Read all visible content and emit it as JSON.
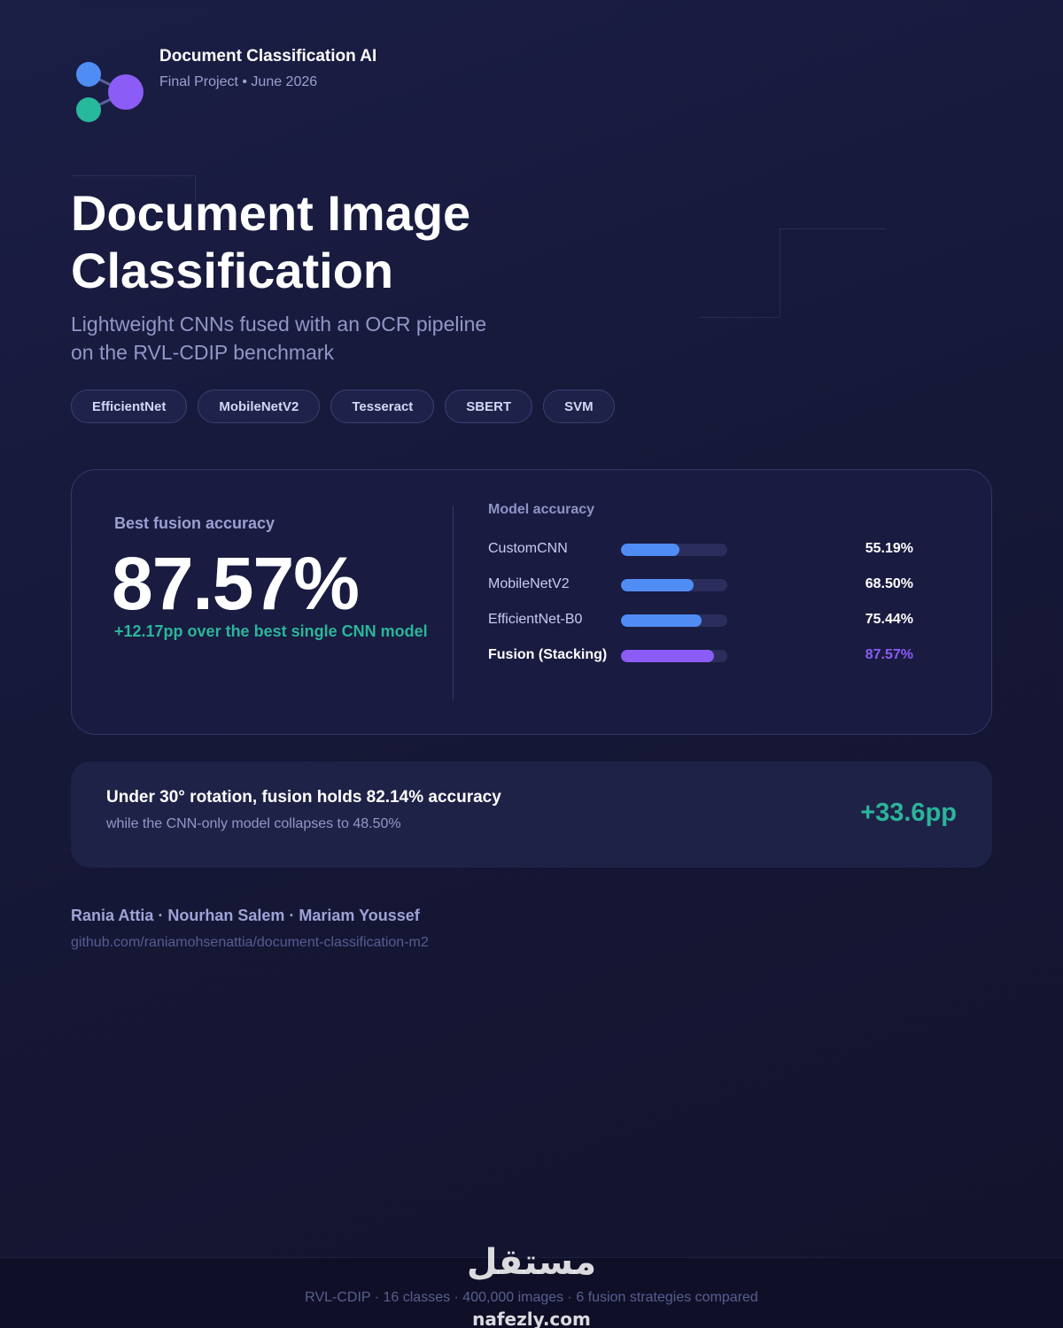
{
  "brand": {
    "title": "Document Classification AI",
    "subtitle": "Final Project • June 2026",
    "logo_icon": "molecule-nodes-icon"
  },
  "hero": {
    "title_line1": "Document Image",
    "title_line2": "Classification",
    "subtitle_line1": "Lightweight CNNs fused with an OCR pipeline",
    "subtitle_line2": "on the RVL-CDIP benchmark"
  },
  "tags": [
    "EfficientNet",
    "MobileNetV2",
    "Tesseract",
    "SBERT",
    "SVM"
  ],
  "results_card": {
    "best_label": "Best fusion accuracy",
    "best_value": "87.57%",
    "best_delta": "+12.17pp over the best single CNN model"
  },
  "chart_data": {
    "type": "bar",
    "title": "Model accuracy",
    "categories": [
      "CustomCNN",
      "MobileNetV2",
      "EfficientNet-B0",
      "Fusion (Stacking)"
    ],
    "values": [
      55.19,
      68.5,
      75.44,
      87.57
    ],
    "value_labels": [
      "55.19%",
      "68.50%",
      "75.44%",
      "87.57%"
    ],
    "xlim": [
      0,
      100
    ],
    "highlight_index": 3,
    "colors": {
      "default": "#4f8df5",
      "highlight": "#8b5cf6",
      "track": "#2b2e5c"
    }
  },
  "banner": {
    "title": "Under 30° rotation, fusion holds 82.14% accuracy",
    "subtitle": "while the CNN-only model collapses to 48.50%",
    "value": "+33.6pp"
  },
  "credits": {
    "authors": "Rania Attia · Nourhan Salem · Mariam Youssef",
    "repo": "github.com/raniamohsenattia/document-classification-m2"
  },
  "footer": {
    "text": "RVL-CDIP · 16 classes · 400,000 images · 6 fusion strategies compared"
  },
  "watermark": {
    "arabic": "مستقل",
    "latin": "nafezly.com"
  },
  "colors": {
    "accent_blue": "#4f8df5",
    "accent_purple": "#8b5cf6",
    "accent_teal": "#2bb59a",
    "background": "#161838"
  }
}
